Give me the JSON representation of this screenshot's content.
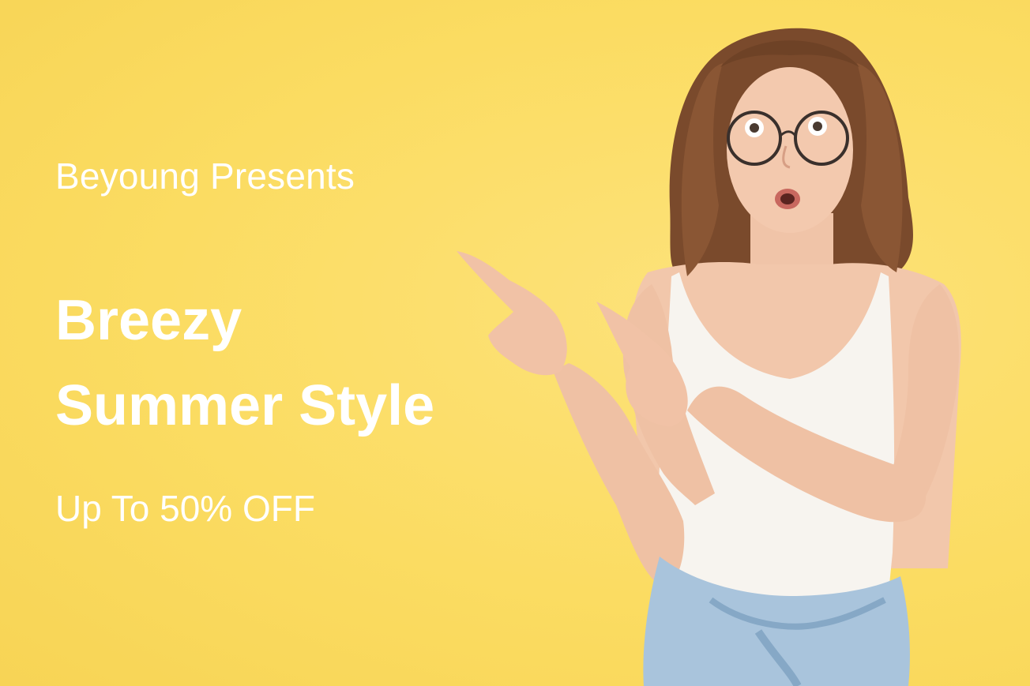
{
  "banner": {
    "brand_line": "Beyoung Presents",
    "headline_line1": "Breezy",
    "headline_line2": "Summer Style",
    "offer": "Up To 50% OFF"
  },
  "colors": {
    "background": "#fbdc62",
    "text": "#ffffff"
  },
  "image": {
    "subject": "surprised-woman-pointing-icon"
  }
}
